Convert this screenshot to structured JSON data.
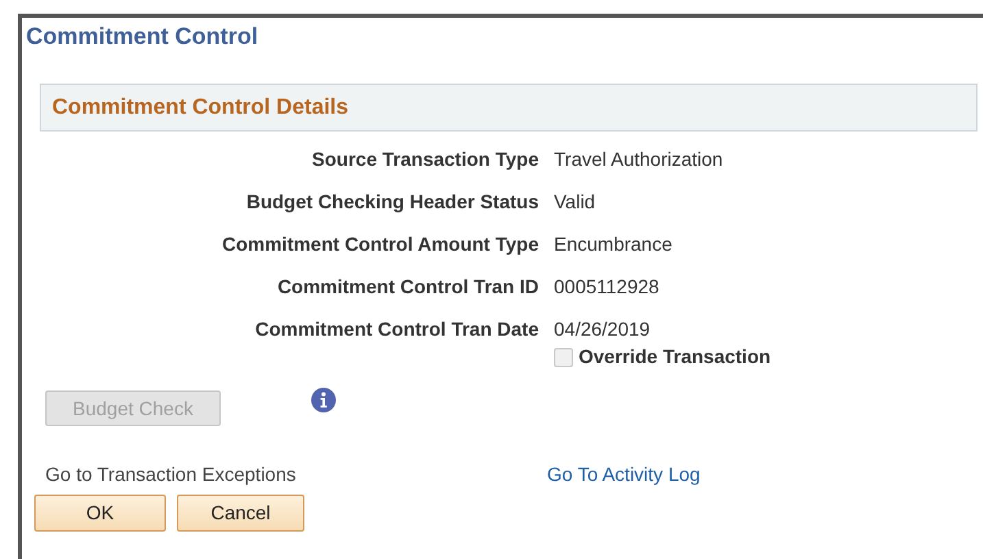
{
  "page_title": "Commitment Control",
  "section": {
    "title": "Commitment Control Details"
  },
  "fields": [
    {
      "label": "Source Transaction Type",
      "value": "Travel Authorization"
    },
    {
      "label": "Budget Checking Header Status",
      "value": "Valid"
    },
    {
      "label": "Commitment Control Amount Type",
      "value": "Encumbrance"
    },
    {
      "label": "Commitment Control Tran ID",
      "value": "0005112928"
    },
    {
      "label": "Commitment Control Tran Date",
      "value": "04/26/2019"
    }
  ],
  "override_checkbox": {
    "label": "Override Transaction",
    "checked": false,
    "disabled": true
  },
  "budget_check_button": {
    "label": "Budget Check",
    "disabled": true
  },
  "links": [
    {
      "label": "Go to Transaction Exceptions",
      "disabled": true
    },
    {
      "label": "Go To Activity Log",
      "disabled": false
    }
  ],
  "buttons": [
    "OK",
    "Cancel"
  ]
}
